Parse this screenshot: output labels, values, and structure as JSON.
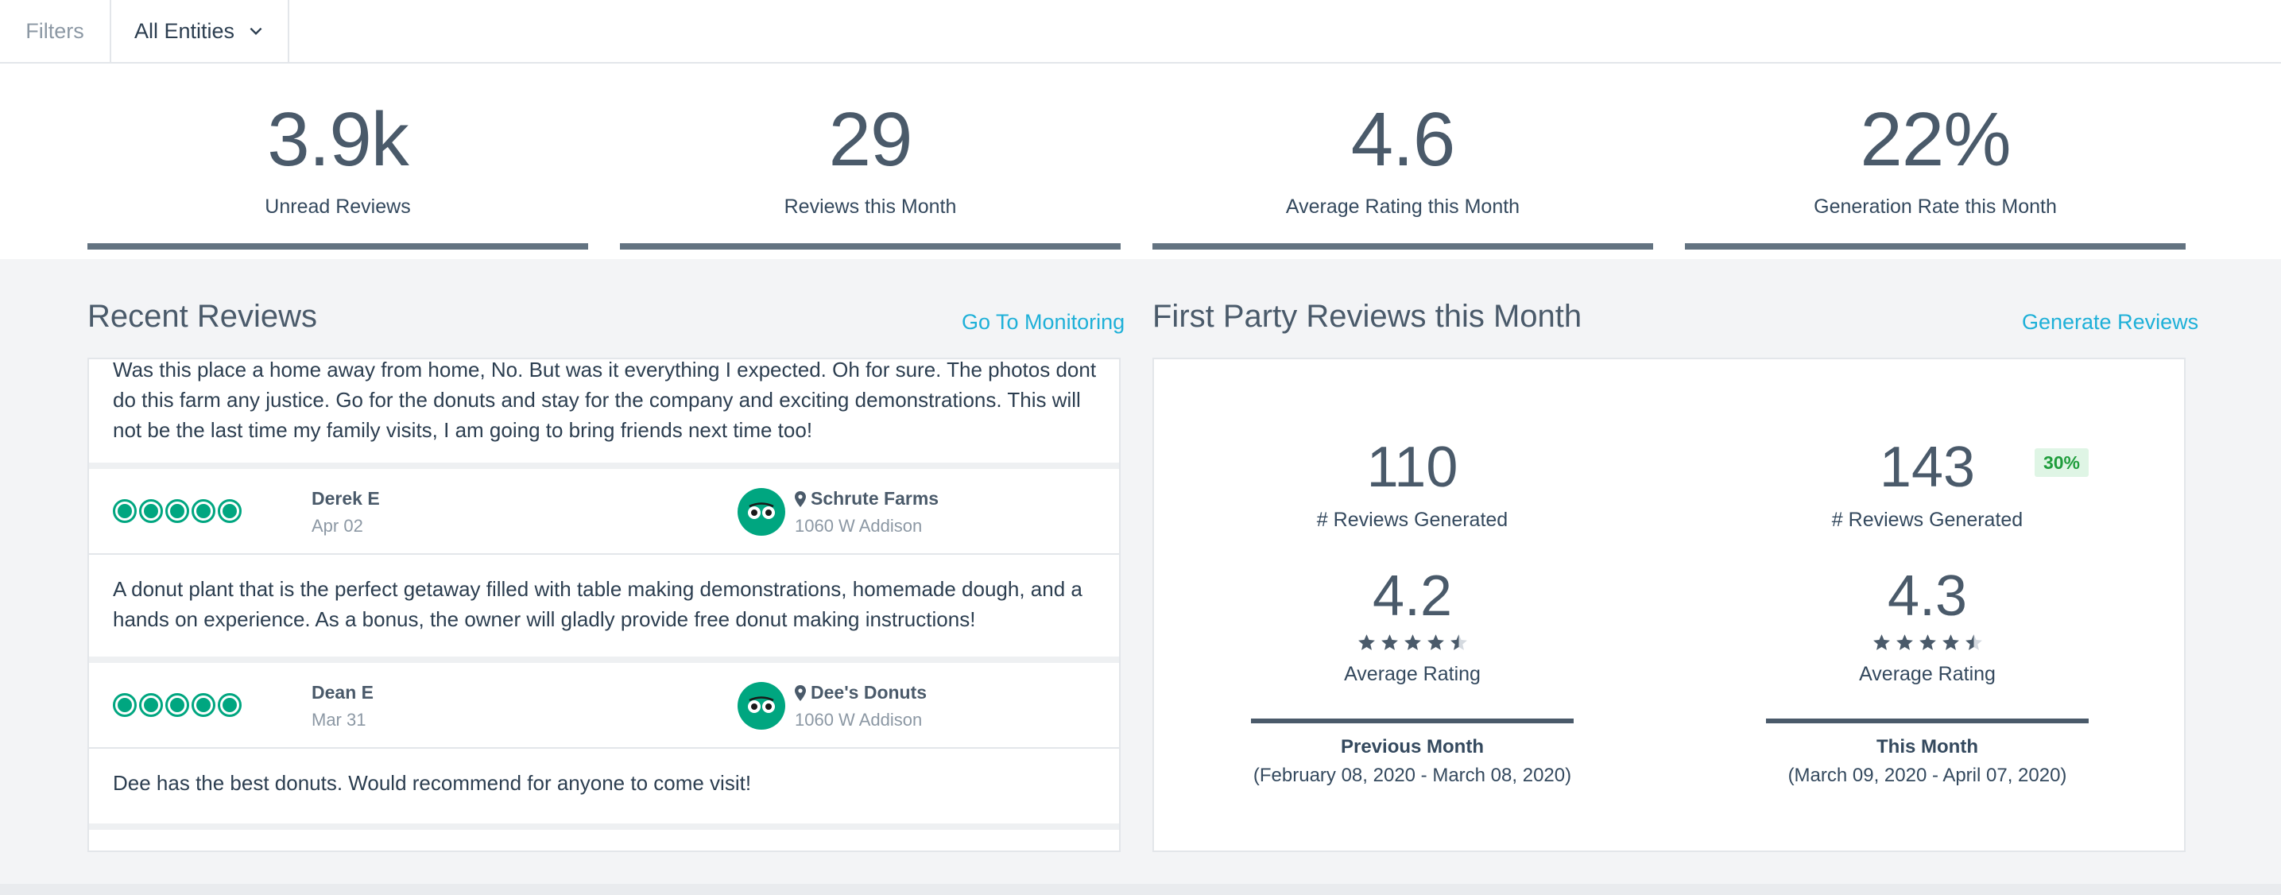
{
  "filters": {
    "label": "Filters",
    "entity_select": "All Entities"
  },
  "metrics": [
    {
      "value": "3.9k",
      "label": "Unread Reviews"
    },
    {
      "value": "29",
      "label": "Reviews this Month"
    },
    {
      "value": "4.6",
      "label": "Average Rating this Month"
    },
    {
      "value": "22%",
      "label": "Generation Rate this Month"
    }
  ],
  "recent_reviews": {
    "title": "Recent Reviews",
    "link": "Go To Monitoring",
    "first_text": "Was this place a home away from home, No. But was it everything I expected. Oh for sure. The photos dont do this farm any justice. Go for the donuts and stay for the company and exciting demonstrations. This will not be the last time my family visits, I am going to bring friends next time too!",
    "items": [
      {
        "rating": 5,
        "name": "Derek E",
        "date": "Apr 02",
        "source_icon": "tripadvisor-owl-icon",
        "location": "Schrute Farms",
        "address": "1060 W Addison",
        "text": "A donut plant that is the perfect getaway filled with table making demonstrations, homemade dough, and a hands on experience. As a bonus, the owner will gladly provide free donut making instructions!"
      },
      {
        "rating": 5,
        "name": "Dean E",
        "date": "Mar 31",
        "source_icon": "tripadvisor-owl-icon",
        "location": "Dee's Donuts",
        "address": "1060 W Addison",
        "text": "Dee has the best donuts. Would recommend for anyone to come visit!"
      }
    ]
  },
  "first_party": {
    "title": "First Party Reviews this Month",
    "link": "Generate Reviews",
    "previous": {
      "generated": "110",
      "generated_label": "# Reviews Generated",
      "rating": "4.2",
      "stars": 4.5,
      "rating_label": "Average Rating",
      "period": "Previous Month",
      "range": "(February 08, 2020 - March 08, 2020)"
    },
    "current": {
      "generated": "143",
      "generated_label": "# Reviews Generated",
      "badge": "30%",
      "rating": "4.3",
      "stars": 4.5,
      "rating_label": "Average Rating",
      "period": "This Month",
      "range": "(March 09, 2020 - April 07, 2020)"
    }
  },
  "colors": {
    "accent_link": "#1eb0d8",
    "tripadvisor_green": "#00a680",
    "badge_green": "#1f9d3c",
    "metric_bar": "#637381"
  }
}
